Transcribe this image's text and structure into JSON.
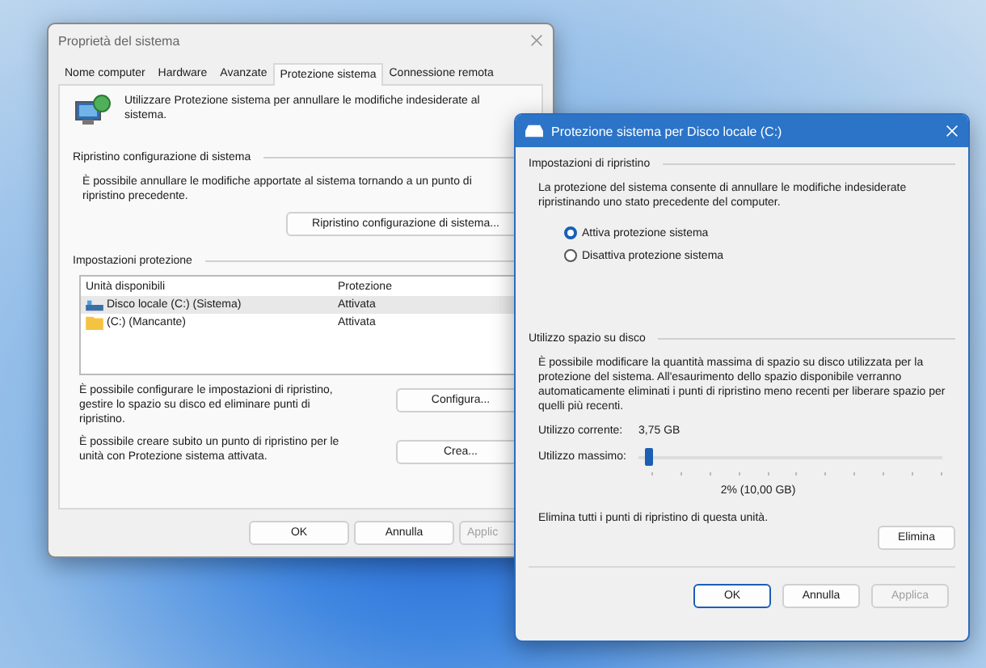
{
  "system_properties": {
    "title": "Proprietà del sistema",
    "tabs": [
      {
        "label": "Nome computer",
        "selected": false
      },
      {
        "label": "Hardware",
        "selected": false
      },
      {
        "label": "Avanzate",
        "selected": false
      },
      {
        "label": "Protezione sistema",
        "selected": true
      },
      {
        "label": "Connessione remota",
        "selected": false
      }
    ],
    "intro": "Utilizzare Protezione sistema per annullare le modifiche indesiderate al sistema.",
    "restore_section": {
      "heading": "Ripristino configurazione di sistema",
      "text": "È possibile annullare le modifiche apportate al sistema tornando a un punto di ripristino precedente.",
      "button": "Ripristino configurazione di sistema..."
    },
    "protection_section": {
      "heading": "Impostazioni protezione",
      "columns": [
        "Unità disponibili",
        "Protezione"
      ],
      "drives": [
        {
          "name": "Disco locale (C:) (Sistema)",
          "kind": "disk",
          "protection": "Attivata",
          "selected": true
        },
        {
          "name": "(C:) (Mancante)",
          "kind": "folder",
          "protection": "Attivata",
          "selected": false
        }
      ],
      "actions": [
        {
          "text": "È possibile configurare le impostazioni di ripristino, gestire lo spazio su disco ed eliminare punti di ripristino.",
          "button": "Configura..."
        },
        {
          "text": "È possibile creare subito un punto di ripristino per le unità con Protezione sistema attivata.",
          "button": "Crea..."
        }
      ]
    },
    "buttons": [
      {
        "label": "OK",
        "disabled": false
      },
      {
        "label": "Annulla",
        "disabled": false
      },
      {
        "label": "Applic",
        "disabled": true
      }
    ]
  },
  "protection_dialog": {
    "title": "Protezione sistema per Disco locale (C:)",
    "restore_heading": "Impostazioni di ripristino",
    "restore_text": "La protezione del sistema consente di annullare le modifiche indesiderate ripristinando uno stato precedente del computer.",
    "options": [
      {
        "label": "Attiva protezione sistema",
        "selected": true
      },
      {
        "label": "Disattiva protezione sistema",
        "selected": false
      }
    ],
    "disk_heading": "Utilizzo spazio su disco",
    "disk_text": "È possibile modificare la quantità massima di spazio su disco utilizzata per la protezione del sistema. All'esaurimento dello spazio disponibile verranno automaticamente eliminati i punti di ripristino meno recenti per liberare spazio per quelli più recenti.",
    "current_label": "Utilizzo corrente:",
    "current_value": "3,75 GB",
    "max_label": "Utilizzo massimo:",
    "slider": {
      "level": 0.02
    },
    "max_value": "2% (10,00 GB)",
    "delete_text": "Elimina tutti i punti di ripristino di questa unità.",
    "delete_button": "Elimina",
    "buttons": [
      {
        "label": "OK",
        "disabled": false
      },
      {
        "label": "Annulla",
        "disabled": false
      },
      {
        "label": "Applica",
        "disabled": true
      }
    ]
  }
}
